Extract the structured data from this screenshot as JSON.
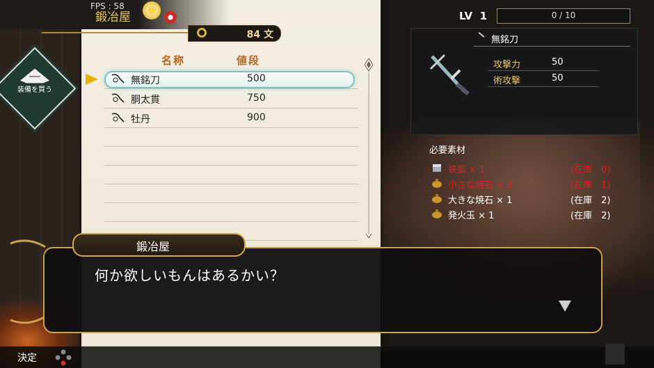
{
  "hud": {
    "fps": "FPS : 58",
    "shop_name": "鍛冶屋",
    "money": "84 文",
    "emblem_label": "装備を買う",
    "level_label": "LV",
    "level_value": "1",
    "exp_text": "0 / 10"
  },
  "shop_list": {
    "header_name": "名称",
    "header_price": "値段",
    "items": [
      {
        "name": "無銘刀",
        "price": "500",
        "selected": true
      },
      {
        "name": "胴太貫",
        "price": "750",
        "selected": false
      },
      {
        "name": "牡丹",
        "price": "900",
        "selected": false
      }
    ],
    "empty_rows": 6
  },
  "detail": {
    "name": "無銘刀",
    "stats": [
      {
        "label": "攻撃力",
        "value": "50"
      },
      {
        "label": "術攻撃",
        "value": "50"
      }
    ]
  },
  "materials": {
    "title": "必要素材",
    "items": [
      {
        "name": "鉄鉱 × 1",
        "stock": "(在庫　0)",
        "status": "lack",
        "icon": "ore-icon"
      },
      {
        "name": "小さな焼石 × 2",
        "stock": "(在庫　1)",
        "status": "lack",
        "icon": "bag-icon"
      },
      {
        "name": "大きな焼石 × 1",
        "stock": "(在庫　2)",
        "status": "ok",
        "icon": "bag-icon"
      },
      {
        "name": "発火玉 × 1",
        "stock": "(在庫　2)",
        "status": "ok",
        "icon": "bag-icon"
      }
    ]
  },
  "dialogue": {
    "speaker": "鍛冶屋",
    "text": "何か欲しいもんはあるかい？"
  },
  "controls": {
    "confirm_label": "決定"
  },
  "colors": {
    "gold": "#d2a84c",
    "lack_red": "#d22222",
    "selection_cyan": "#7cc0c0"
  }
}
